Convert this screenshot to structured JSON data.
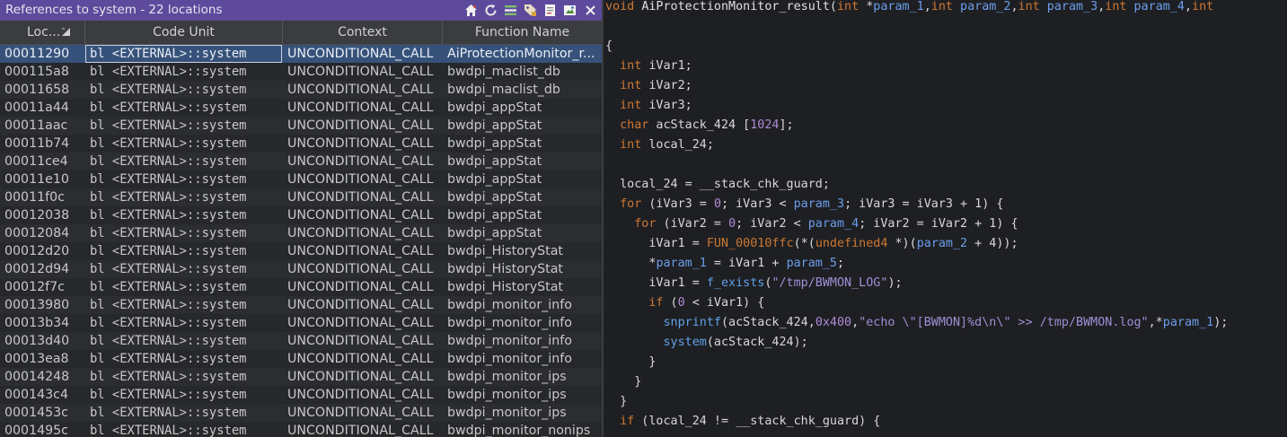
{
  "refs_panel": {
    "title": "References to system - 22 locations",
    "toolbar_icons": [
      "home-icon",
      "refresh-icon",
      "list-icon",
      "tag-icon",
      "document-icon",
      "snapshot-icon",
      "close-icon"
    ],
    "columns": [
      "Loc...",
      "Code Unit",
      "Context",
      "Function Name"
    ],
    "rows": [
      {
        "loc": "00011290",
        "code": "bl <EXTERNAL>::system",
        "context": "UNCONDITIONAL_CALL",
        "function": "AiProtectionMonitor_r..."
      },
      {
        "loc": "000115a8",
        "code": "bl <EXTERNAL>::system",
        "context": "UNCONDITIONAL_CALL",
        "function": "bwdpi_maclist_db"
      },
      {
        "loc": "00011658",
        "code": "bl <EXTERNAL>::system",
        "context": "UNCONDITIONAL_CALL",
        "function": "bwdpi_maclist_db"
      },
      {
        "loc": "00011a44",
        "code": "bl <EXTERNAL>::system",
        "context": "UNCONDITIONAL_CALL",
        "function": "bwdpi_appStat"
      },
      {
        "loc": "00011aac",
        "code": "bl <EXTERNAL>::system",
        "context": "UNCONDITIONAL_CALL",
        "function": "bwdpi_appStat"
      },
      {
        "loc": "00011b74",
        "code": "bl <EXTERNAL>::system",
        "context": "UNCONDITIONAL_CALL",
        "function": "bwdpi_appStat"
      },
      {
        "loc": "00011ce4",
        "code": "bl <EXTERNAL>::system",
        "context": "UNCONDITIONAL_CALL",
        "function": "bwdpi_appStat"
      },
      {
        "loc": "00011e10",
        "code": "bl <EXTERNAL>::system",
        "context": "UNCONDITIONAL_CALL",
        "function": "bwdpi_appStat"
      },
      {
        "loc": "00011f0c",
        "code": "bl <EXTERNAL>::system",
        "context": "UNCONDITIONAL_CALL",
        "function": "bwdpi_appStat"
      },
      {
        "loc": "00012038",
        "code": "bl <EXTERNAL>::system",
        "context": "UNCONDITIONAL_CALL",
        "function": "bwdpi_appStat"
      },
      {
        "loc": "00012084",
        "code": "bl <EXTERNAL>::system",
        "context": "UNCONDITIONAL_CALL",
        "function": "bwdpi_appStat"
      },
      {
        "loc": "00012d20",
        "code": "bl <EXTERNAL>::system",
        "context": "UNCONDITIONAL_CALL",
        "function": "bwdpi_HistoryStat"
      },
      {
        "loc": "00012d94",
        "code": "bl <EXTERNAL>::system",
        "context": "UNCONDITIONAL_CALL",
        "function": "bwdpi_HistoryStat"
      },
      {
        "loc": "00012f7c",
        "code": "bl <EXTERNAL>::system",
        "context": "UNCONDITIONAL_CALL",
        "function": "bwdpi_HistoryStat"
      },
      {
        "loc": "00013980",
        "code": "bl <EXTERNAL>::system",
        "context": "UNCONDITIONAL_CALL",
        "function": "bwdpi_monitor_info"
      },
      {
        "loc": "00013b34",
        "code": "bl <EXTERNAL>::system",
        "context": "UNCONDITIONAL_CALL",
        "function": "bwdpi_monitor_info"
      },
      {
        "loc": "00013d40",
        "code": "bl <EXTERNAL>::system",
        "context": "UNCONDITIONAL_CALL",
        "function": "bwdpi_monitor_info"
      },
      {
        "loc": "00013ea8",
        "code": "bl <EXTERNAL>::system",
        "context": "UNCONDITIONAL_CALL",
        "function": "bwdpi_monitor_info"
      },
      {
        "loc": "00014248",
        "code": "bl <EXTERNAL>::system",
        "context": "UNCONDITIONAL_CALL",
        "function": "bwdpi_monitor_ips"
      },
      {
        "loc": "000143c4",
        "code": "bl <EXTERNAL>::system",
        "context": "UNCONDITIONAL_CALL",
        "function": "bwdpi_monitor_ips"
      },
      {
        "loc": "0001453c",
        "code": "bl <EXTERNAL>::system",
        "context": "UNCONDITIONAL_CALL",
        "function": "bwdpi_monitor_ips"
      },
      {
        "loc": "0001495c",
        "code": "bl <EXTERNAL>::system",
        "context": "UNCONDITIONAL_CALL",
        "function": "bwdpi_monitor_nonips"
      }
    ]
  },
  "decompiler": {
    "lines": [
      [
        [
          "kw",
          "void"
        ],
        [
          "pl",
          " "
        ],
        [
          "wh",
          "AiProtectionMonitor_result"
        ],
        [
          "pl",
          "("
        ],
        [
          "ty",
          "int"
        ],
        [
          "pl",
          " *"
        ],
        [
          "pa",
          "param_1"
        ],
        [
          "pl",
          ","
        ],
        [
          "ty",
          "int"
        ],
        [
          "pl",
          " "
        ],
        [
          "pa",
          "param_2"
        ],
        [
          "pl",
          ","
        ],
        [
          "ty",
          "int"
        ],
        [
          "pl",
          " "
        ],
        [
          "pa",
          "param_3"
        ],
        [
          "pl",
          ","
        ],
        [
          "ty",
          "int"
        ],
        [
          "pl",
          " "
        ],
        [
          "pa",
          "param_4"
        ],
        [
          "pl",
          ","
        ],
        [
          "ty",
          "int"
        ]
      ],
      [],
      [
        [
          "pl",
          "{"
        ]
      ],
      [
        [
          "pl",
          "  "
        ],
        [
          "ty",
          "int"
        ],
        [
          "pl",
          " iVar1;"
        ]
      ],
      [
        [
          "pl",
          "  "
        ],
        [
          "ty",
          "int"
        ],
        [
          "pl",
          " iVar2;"
        ]
      ],
      [
        [
          "pl",
          "  "
        ],
        [
          "ty",
          "int"
        ],
        [
          "pl",
          " iVar3;"
        ]
      ],
      [
        [
          "pl",
          "  "
        ],
        [
          "ty",
          "char"
        ],
        [
          "pl",
          " acStack_424 ["
        ],
        [
          "nu",
          "1024"
        ],
        [
          "pl",
          "];"
        ]
      ],
      [
        [
          "pl",
          "  "
        ],
        [
          "ty",
          "int"
        ],
        [
          "pl",
          " local_24;"
        ]
      ],
      [],
      [
        [
          "pl",
          "  local_24 = __stack_chk_guard;"
        ]
      ],
      [
        [
          "pl",
          "  "
        ],
        [
          "kw",
          "for"
        ],
        [
          "pl",
          " (iVar3 = "
        ],
        [
          "nu",
          "0"
        ],
        [
          "pl",
          "; iVar3 < "
        ],
        [
          "pa",
          "param_3"
        ],
        [
          "pl",
          "; iVar3 = iVar3 + 1) {"
        ]
      ],
      [
        [
          "pl",
          "    "
        ],
        [
          "kw",
          "for"
        ],
        [
          "pl",
          " (iVar2 = "
        ],
        [
          "nu",
          "0"
        ],
        [
          "pl",
          "; iVar2 < "
        ],
        [
          "pa",
          "param_4"
        ],
        [
          "pl",
          "; iVar2 = iVar2 + 1) {"
        ]
      ],
      [
        [
          "pl",
          "      iVar1 = "
        ],
        [
          "kw",
          "FUN_00010ffc"
        ],
        [
          "pl",
          "(*("
        ],
        [
          "ty",
          "undefined4"
        ],
        [
          "pl",
          " *)("
        ],
        [
          "pa",
          "param_2"
        ],
        [
          "pl",
          " + 4));"
        ]
      ],
      [
        [
          "pl",
          "      *"
        ],
        [
          "pa",
          "param_1"
        ],
        [
          "pl",
          " = iVar1 + "
        ],
        [
          "pa",
          "param_5"
        ],
        [
          "pl",
          ";"
        ]
      ],
      [
        [
          "pl",
          "      iVar1 = "
        ],
        [
          "fn",
          "f_exists"
        ],
        [
          "pl",
          "("
        ],
        [
          "st",
          "\"/tmp/BWMON_LOG\""
        ],
        [
          "pl",
          ");"
        ]
      ],
      [
        [
          "pl",
          "      "
        ],
        [
          "kw",
          "if"
        ],
        [
          "pl",
          " ("
        ],
        [
          "nu",
          "0"
        ],
        [
          "pl",
          " < iVar1) {"
        ]
      ],
      [
        [
          "pl",
          "        "
        ],
        [
          "fn",
          "snprintf"
        ],
        [
          "pl",
          "(acStack_424,"
        ],
        [
          "nu",
          "0x400"
        ],
        [
          "pl",
          ","
        ],
        [
          "st",
          "\"echo \\\"[BWMON]%d\\n\\\" >> /tmp/BWMON.log\""
        ],
        [
          "pl",
          ",*"
        ],
        [
          "pa",
          "param_1"
        ],
        [
          "pl",
          ");"
        ]
      ],
      [
        [
          "pl",
          "        "
        ],
        [
          "fn",
          "system"
        ],
        [
          "pl",
          "(acStack_424);"
        ]
      ],
      [
        [
          "pl",
          "      }"
        ]
      ],
      [
        [
          "pl",
          "    }"
        ]
      ],
      [
        [
          "pl",
          "  }"
        ]
      ],
      [
        [
          "pl",
          "  "
        ],
        [
          "kw",
          "if"
        ],
        [
          "pl",
          " (local_24 != __stack_chk_guard) {"
        ]
      ]
    ]
  }
}
